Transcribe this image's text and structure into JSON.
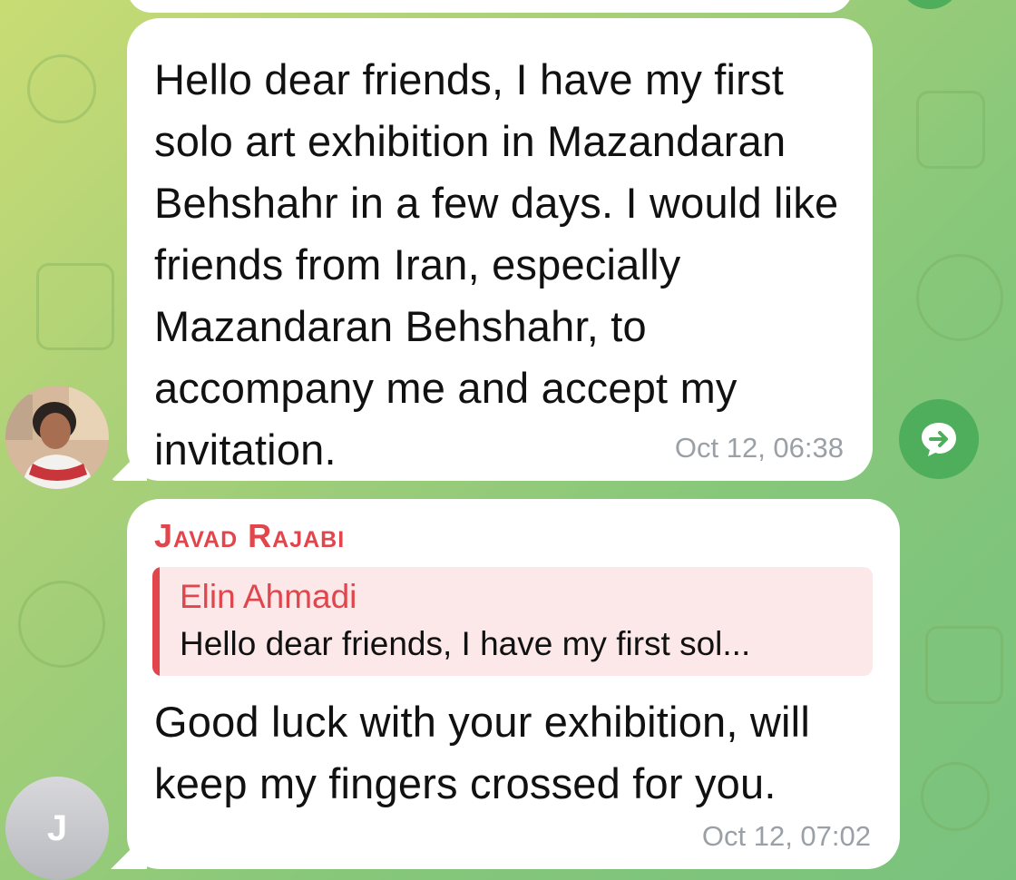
{
  "messages": [
    {
      "text": "Hello dear friends, I have my first solo art exhibition in Mazandaran Behshahr in a few days. I would like friends from Iran, especially Mazandaran Behshahr, to accompany me and accept my invitation.",
      "time": "Oct 12, 06:38"
    },
    {
      "sender": "Javad Rajabi",
      "reply": {
        "name": "Elin Ahmadi",
        "text": "Hello dear friends, I have my first sol..."
      },
      "text": "Good luck with your exhibition, will keep my fingers crossed for you.",
      "time": "Oct 12, 07:02",
      "avatar_initial": "J"
    }
  ],
  "icons": {
    "share": "share-arrow-icon"
  },
  "colors": {
    "accent_green": "#4fae5b",
    "sender_red": "#e0464b",
    "reply_bg": "#fce8e9",
    "timestamp": "#9aa0a6"
  }
}
